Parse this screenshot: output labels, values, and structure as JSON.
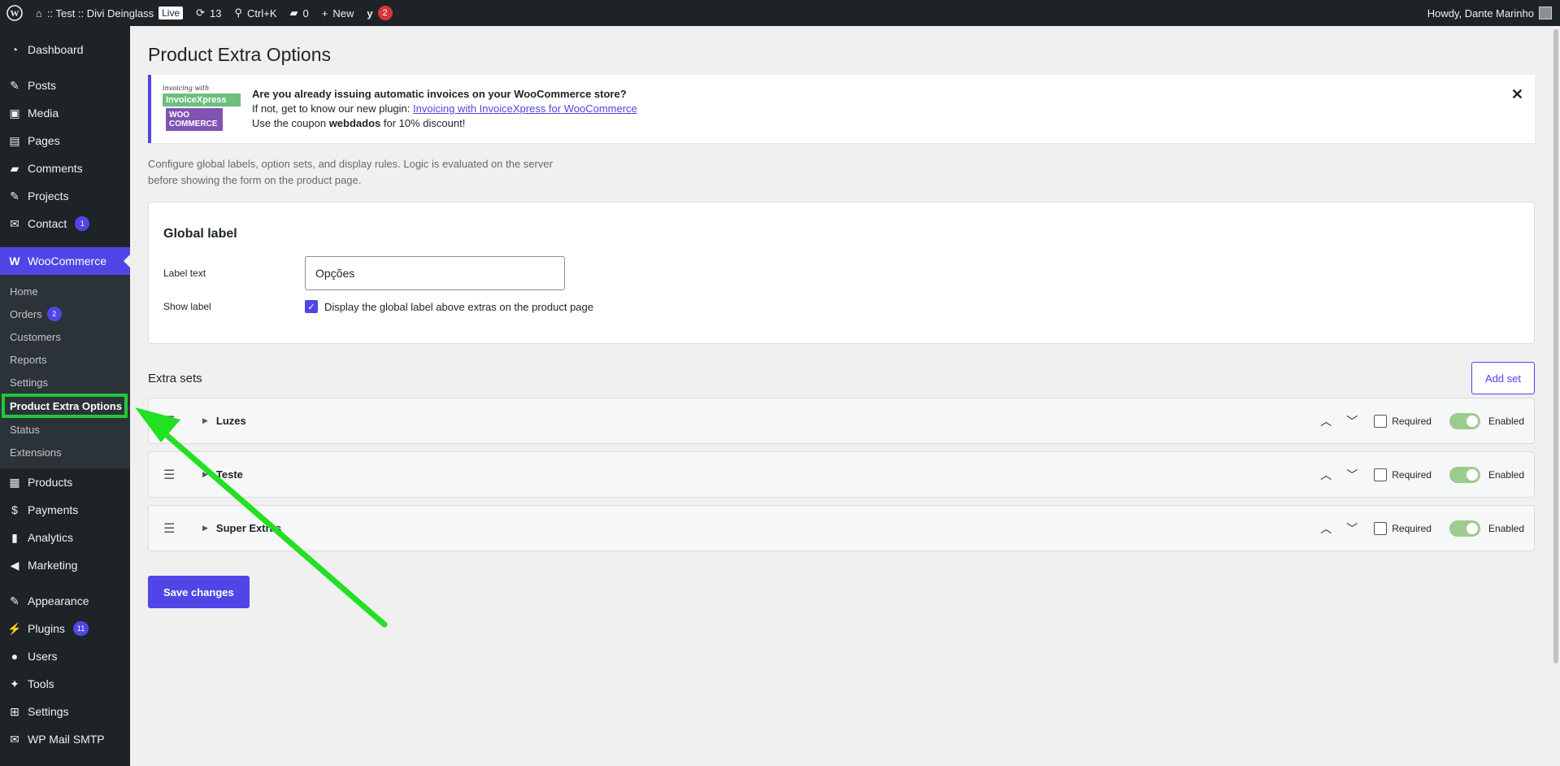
{
  "adminbar": {
    "site_name": ":: Test :: Divi Deinglass",
    "live": "Live",
    "updates_count": "13",
    "shortcut": "Ctrl+K",
    "comments_count": "0",
    "new_label": "New",
    "yoast_count": "2",
    "howdy": "Howdy, Dante Marinho"
  },
  "sidebar": {
    "dashboard": "Dashboard",
    "posts": "Posts",
    "media": "Media",
    "pages": "Pages",
    "comments": "Comments",
    "projects": "Projects",
    "contact": "Contact",
    "contact_count": "1",
    "woocommerce": "WooCommerce",
    "sub": {
      "home": "Home",
      "orders": "Orders",
      "orders_count": "2",
      "customers": "Customers",
      "reports": "Reports",
      "settings": "Settings",
      "product_extra_options": "Product Extra Options",
      "status": "Status",
      "extensions": "Extensions"
    },
    "products": "Products",
    "payments": "Payments",
    "analytics": "Analytics",
    "marketing": "Marketing",
    "appearance": "Appearance",
    "plugins": "Plugins",
    "plugins_count": "11",
    "users": "Users",
    "tools": "Tools",
    "settings": "Settings",
    "wp_mail_smtp": "WP Mail SMTP"
  },
  "page": {
    "title": "Product Extra Options",
    "notice": {
      "logo_top": "invoicing with",
      "logo_mid": "InvoiceXpress",
      "logo_bot": "WOO COMMERCE",
      "heading": "Are you already issuing automatic invoices on your WooCommerce store?",
      "line2_prefix": "If not, get to know our new plugin: ",
      "line2_link": "Invoicing with InvoiceXpress for WooCommerce",
      "line3_prefix": "Use the coupon ",
      "line3_code": "webdados",
      "line3_suffix": " for 10% discount!"
    },
    "intro": "Configure global labels, option sets, and display rules. Logic is evaluated on the server before showing the form on the product page.",
    "global_label": {
      "heading": "Global label",
      "label_text_label": "Label text",
      "label_text_value": "Opções",
      "show_label_label": "Show label",
      "show_label_checkbox": "Display the global label above extras on the product page"
    },
    "extra_sets": {
      "heading": "Extra sets",
      "add_button": "Add set",
      "required_label": "Required",
      "enabled_label": "Enabled",
      "items": [
        {
          "name": "Luzes"
        },
        {
          "name": "Teste"
        },
        {
          "name": "Super Extras"
        }
      ]
    },
    "save_button": "Save changes"
  },
  "colors": {
    "accent": "#4f46e5",
    "highlight": "#22c83a",
    "toggle_on": "#9ccc8f"
  }
}
